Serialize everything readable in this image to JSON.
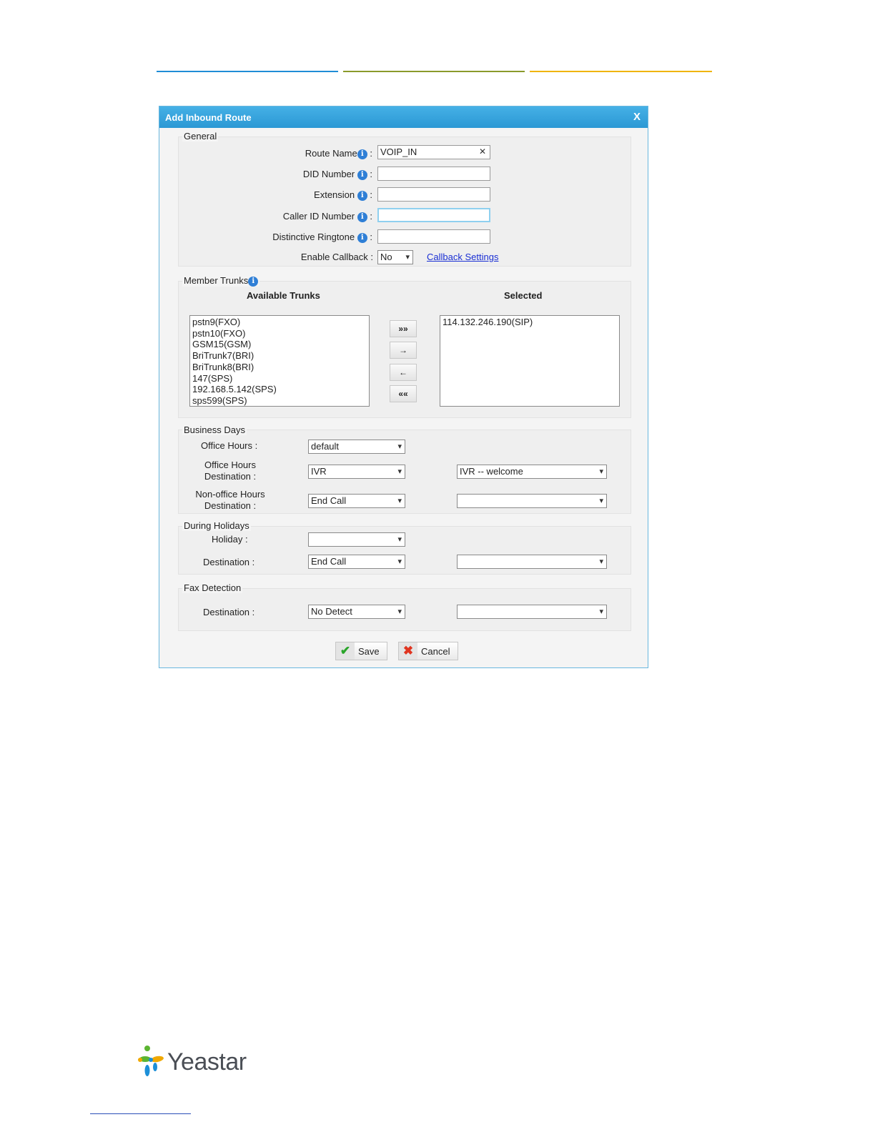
{
  "colors": {
    "header_line_1": "#1f8dd6",
    "header_line_2": "#8a9a2b",
    "header_line_3": "#f0b400",
    "dialog_title_bg": "#2f9fd8",
    "info_icon": "#2f7fd6",
    "link": "#1a2fd4"
  },
  "dialog": {
    "title": "Add Inbound Route",
    "close": "X"
  },
  "general": {
    "legend": "General",
    "route_name_label": "Route Name",
    "route_name_value": "VOIP_IN",
    "did_number_label": "DID Number",
    "extension_label": "Extension",
    "caller_id_label": "Caller ID Number",
    "ringtone_label": "Distinctive Ringtone",
    "callback_label": "Enable Callback :",
    "callback_value": "No",
    "callback_settings": "Callback Settings",
    "colon": ":"
  },
  "trunks": {
    "legend": "Member Trunks",
    "available_header": "Available Trunks",
    "selected_header": "Selected",
    "available": [
      "pstn9(FXO)",
      "pstn10(FXO)",
      "GSM15(GSM)",
      "BriTrunk7(BRI)",
      "BriTrunk8(BRI)",
      "147(SPS)",
      "192.168.5.142(SPS)",
      "sps599(SPS)"
    ],
    "selected": [
      "114.132.246.190(SIP)"
    ],
    "buttons": {
      "add_all": "»»",
      "add": "→",
      "remove": "←",
      "remove_all": "««"
    }
  },
  "business": {
    "legend": "Business Days",
    "office_hours_label": "Office Hours :",
    "office_hours_value": "default",
    "office_dest_label_1": "Office Hours",
    "office_dest_label_2": "Destination :",
    "office_dest_value": "IVR",
    "office_dest_target": "IVR -- welcome",
    "nonoffice_label_1": "Non-office Hours",
    "nonoffice_label_2": "Destination :",
    "nonoffice_value": "End Call",
    "nonoffice_target": ""
  },
  "holidays": {
    "legend": "During Holidays",
    "holiday_label": "Holiday :",
    "holiday_value": "",
    "dest_label": "Destination :",
    "dest_value": "End Call",
    "dest_target": ""
  },
  "fax": {
    "legend": "Fax Detection",
    "dest_label": "Destination :",
    "dest_value": "No Detect",
    "dest_target": ""
  },
  "actions": {
    "save": "Save",
    "cancel": "Cancel"
  },
  "brand": {
    "name": "Yeastar"
  }
}
